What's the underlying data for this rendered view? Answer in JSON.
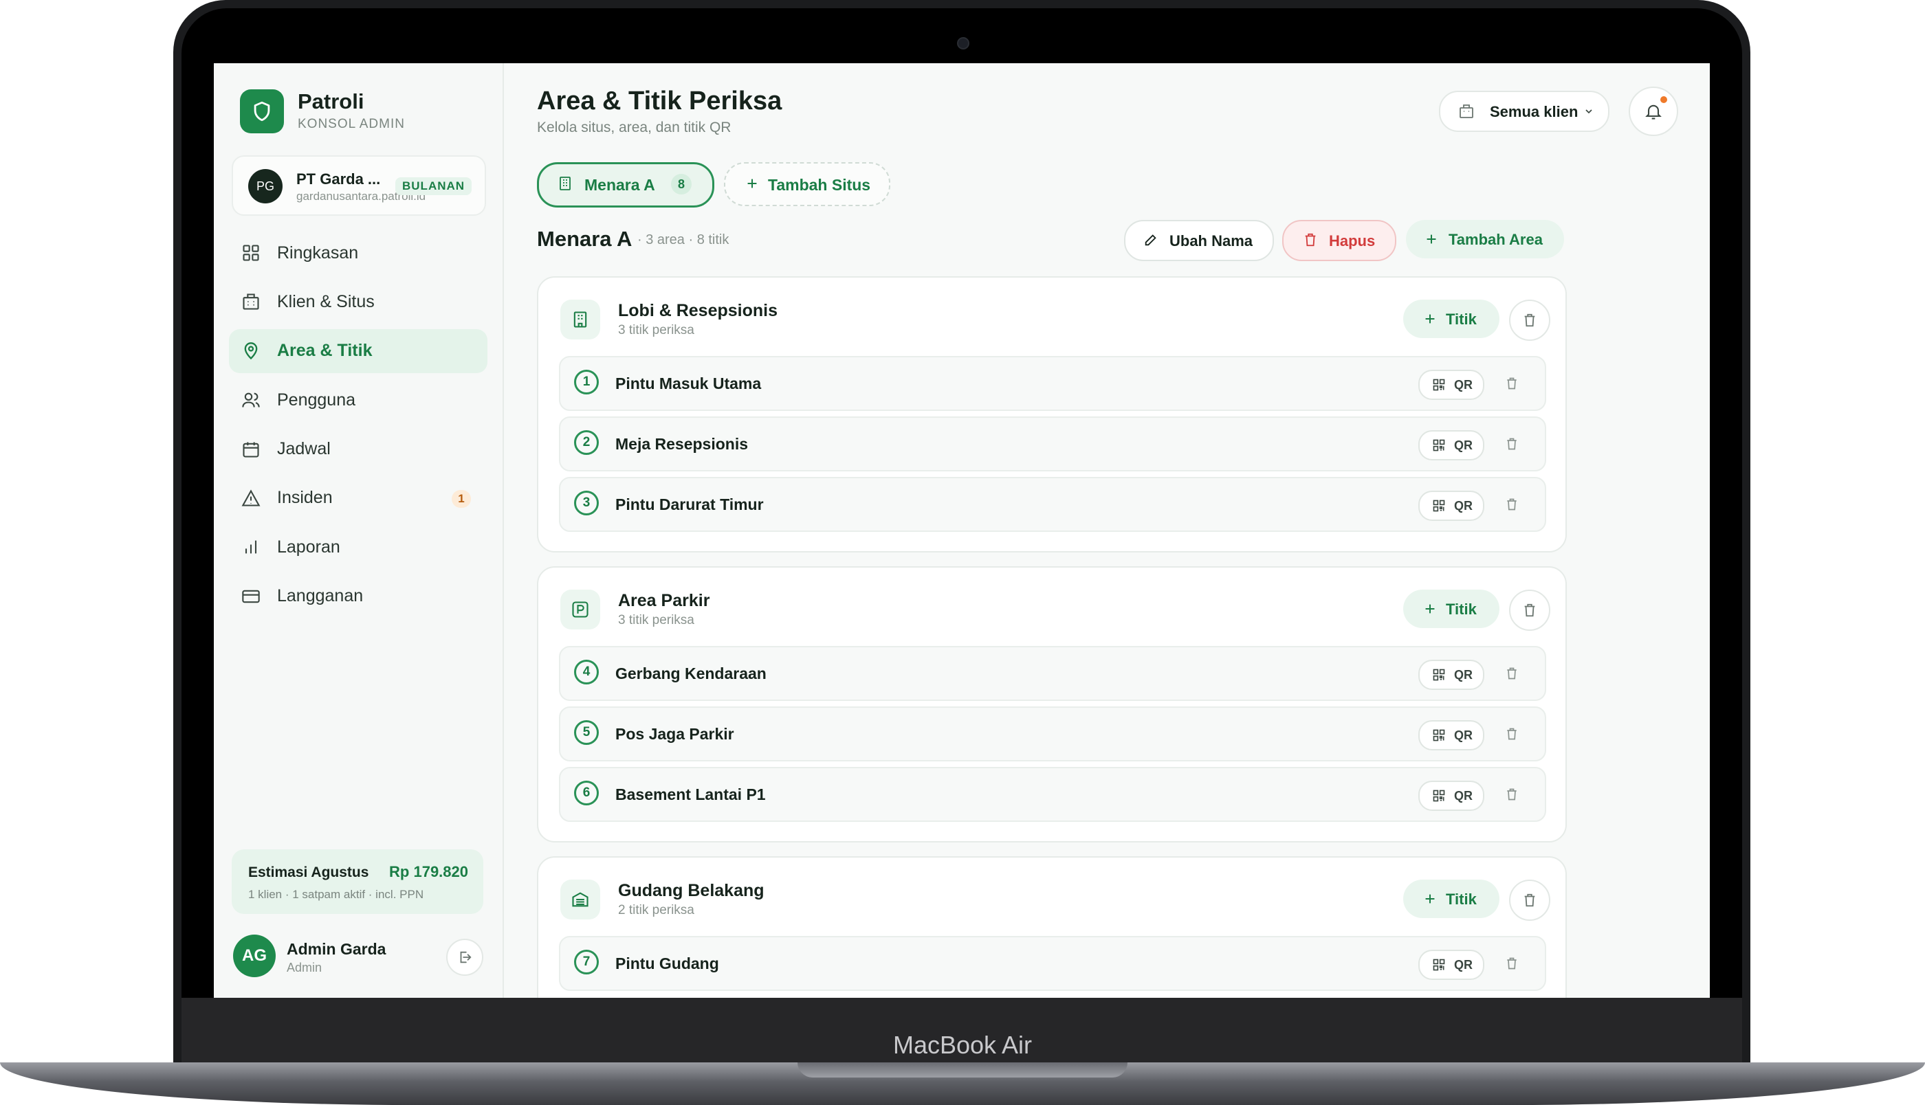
{
  "device": {
    "label": "MacBook Air"
  },
  "app": {
    "name": "Patroli",
    "subtitle": "KONSOL ADMIN"
  },
  "client": {
    "initials": "PG",
    "name": "PT Garda ...",
    "domain": "gardanusantara.patroli.id",
    "plan": "BULANAN"
  },
  "nav": [
    {
      "label": "Ringkasan",
      "icon": "grid-icon"
    },
    {
      "label": "Klien & Situs",
      "icon": "building-icon"
    },
    {
      "label": "Area & Titik",
      "icon": "map-pin-icon",
      "active": true
    },
    {
      "label": "Pengguna",
      "icon": "users-icon"
    },
    {
      "label": "Jadwal",
      "icon": "calendar-icon"
    },
    {
      "label": "Insiden",
      "icon": "alert-triangle-icon",
      "badge": "1"
    },
    {
      "label": "Laporan",
      "icon": "bar-chart-icon"
    },
    {
      "label": "Langganan",
      "icon": "credit-card-icon"
    }
  ],
  "estimate": {
    "title": "Estimasi Agustus",
    "amount": "Rp 179.820",
    "detail": "1 klien · 1 satpam aktif · incl. PPN"
  },
  "user": {
    "initials": "AG",
    "name": "Admin Garda",
    "role": "Admin"
  },
  "header": {
    "title": "Area & Titik Periksa",
    "subtitle": "Kelola situs, area, dan titik QR",
    "client_filter": "Semua klien"
  },
  "tabs": {
    "active_label": "Menara A",
    "active_count": "8",
    "add_label": "Tambah Situs"
  },
  "site": {
    "name": "Menara A",
    "meta": "· 3 area · 8 titik",
    "rename_label": "Ubah Nama",
    "delete_label": "Hapus",
    "add_area_label": "Tambah Area"
  },
  "areas": [
    {
      "name": "Lobi & Resepsionis",
      "count": "3 titik periksa",
      "icon": "building-icon",
      "add_label": "Titik",
      "points": [
        {
          "num": "1",
          "name": "Pintu Masuk Utama"
        },
        {
          "num": "2",
          "name": "Meja Resepsionis"
        },
        {
          "num": "3",
          "name": "Pintu Darurat Timur"
        }
      ]
    },
    {
      "name": "Area Parkir",
      "count": "3 titik periksa",
      "icon": "parking-icon",
      "add_label": "Titik",
      "points": [
        {
          "num": "4",
          "name": "Gerbang Kendaraan"
        },
        {
          "num": "5",
          "name": "Pos Jaga Parkir"
        },
        {
          "num": "6",
          "name": "Basement Lantai P1"
        }
      ]
    },
    {
      "name": "Gudang Belakang",
      "count": "2 titik periksa",
      "icon": "warehouse-icon",
      "add_label": "Titik",
      "points": [
        {
          "num": "7",
          "name": "Pintu Gudang"
        }
      ]
    }
  ],
  "qr_label": "QR",
  "colors": {
    "accent": "#1e8a4c",
    "danger": "#d23b3b",
    "badge_warn": "#b55d0e"
  }
}
